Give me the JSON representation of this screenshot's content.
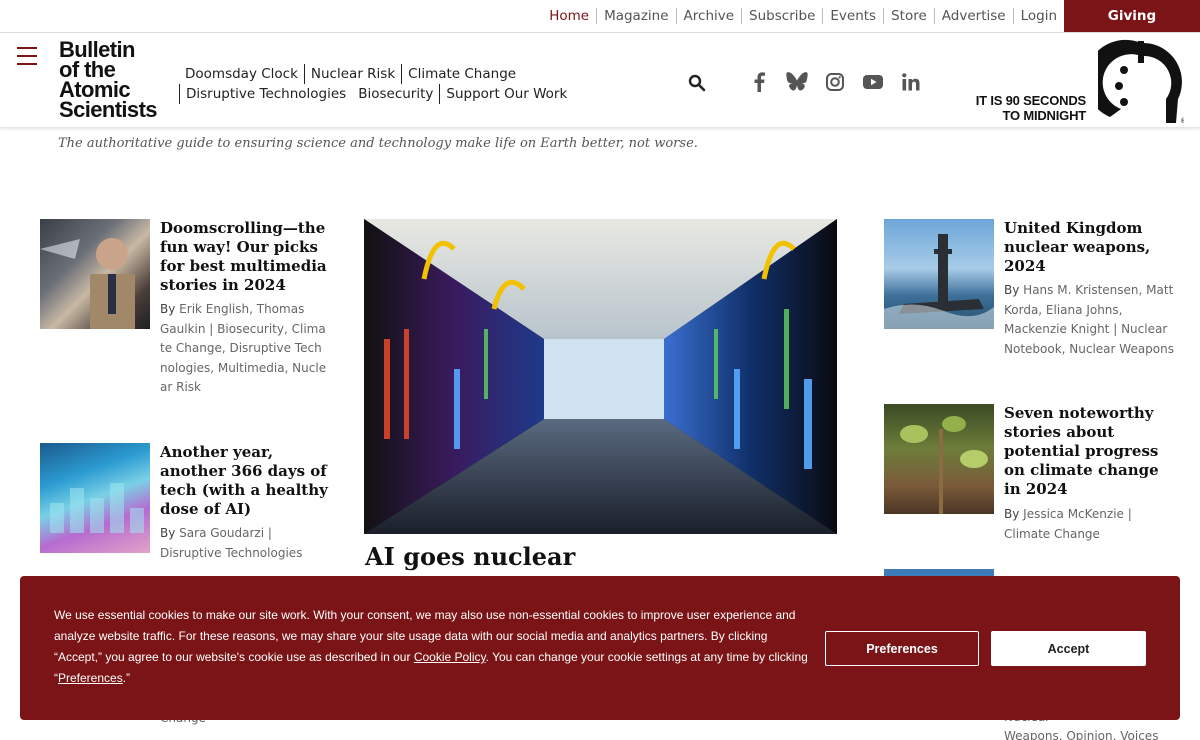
{
  "utility_nav": {
    "items": [
      "Home",
      "Magazine",
      "Archive",
      "Subscribe",
      "Events",
      "Store",
      "Advertise",
      "Login"
    ],
    "active": "Home",
    "giving": "Giving"
  },
  "header": {
    "logo_lines": [
      "Bulletin",
      "of the",
      "Atomic",
      "Scientists"
    ],
    "nav": [
      "Doomsday Clock",
      "Nuclear Risk",
      "Climate Change",
      "Disruptive Technologies",
      "Biosecurity",
      "Support Our Work"
    ],
    "clock_text_line1": "IT IS 90 SECONDS",
    "clock_text_line2": "TO MIDNIGHT",
    "tagline": "The authoritative guide to ensuring science and technology make life on Earth better, not worse."
  },
  "left_articles": [
    {
      "title": "Doomscrolling—the fun way! Our picks for best multimedia stories in 2024",
      "by": "By",
      "authors": "Erik English, Thomas Gaulkin |",
      "categories": "Biosecurity, Climate Change, Disruptive Technologies, Multimedia, Nuclear Risk"
    },
    {
      "title": "Another year, another 366 days of tech (with a healthy dose of AI)",
      "by": "By",
      "authors": "Sara Goudarzi |",
      "categories": "Disruptive Technologies"
    }
  ],
  "hero": {
    "title": "AI goes nuclear"
  },
  "right_articles": [
    {
      "title": "United Kingdom nuclear weapons, 2024",
      "by": "By",
      "authors": "Hans M. Kristensen, Matt Korda, Eliana Johns, Mackenzie Knight |",
      "categories": "Nuclear Notebook, Nuclear Weapons"
    },
    {
      "title": "Seven noteworthy stories about potential progress on climate change in 2024",
      "by": "By",
      "authors": "Jessica McKenzie |",
      "categories": "Climate Change"
    }
  ],
  "peek": {
    "left": "Change",
    "right_top": "Nuclear",
    "right_bottom": "Weapons, Opinion, Voices"
  },
  "cookie": {
    "text_1": "We use essential cookies to make our site work. With your consent, we may also use non-essential cookies to improve user experience and analyze website traffic. For these reasons, we may share your site usage data with our social media and analytics partners. By clicking “Accept,” you agree to our website's cookie use as described in our ",
    "policy_link": "Cookie Policy",
    "text_2": ". You can change your cookie settings at any time by clicking “",
    "preferences_link": "Preferences",
    "text_3": ".”",
    "preferences_button": "Preferences",
    "accept_button": "Accept"
  },
  "colors": {
    "brand": "#7a1416"
  }
}
